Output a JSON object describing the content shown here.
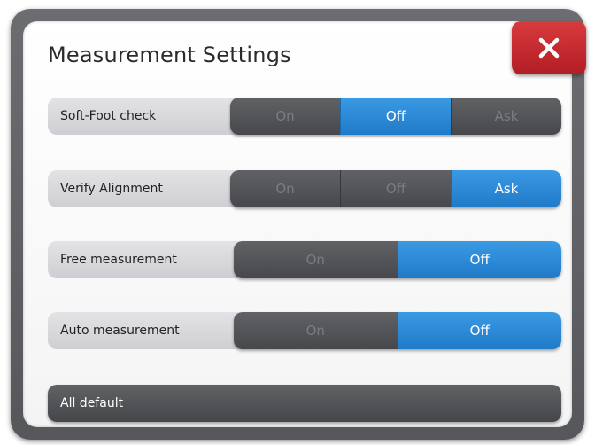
{
  "dialog": {
    "title": "Measurement Settings",
    "close_icon": "close-icon"
  },
  "settings": [
    {
      "label": "Soft-Foot check",
      "options": [
        "On",
        "Off",
        "Ask"
      ],
      "selected": "Off"
    },
    {
      "label": "Verify Alignment",
      "options": [
        "On",
        "Off",
        "Ask"
      ],
      "selected": "Ask"
    },
    {
      "label": "Free measurement",
      "options": [
        "On",
        "Off"
      ],
      "selected": "Off"
    },
    {
      "label": "Auto measurement",
      "options": [
        "On",
        "Off"
      ],
      "selected": "Off"
    }
  ],
  "footer": {
    "all_default_label": "All default"
  },
  "colors": {
    "accent": "#2a8ad8",
    "close": "#c8292f",
    "button_dark": "#505256"
  }
}
